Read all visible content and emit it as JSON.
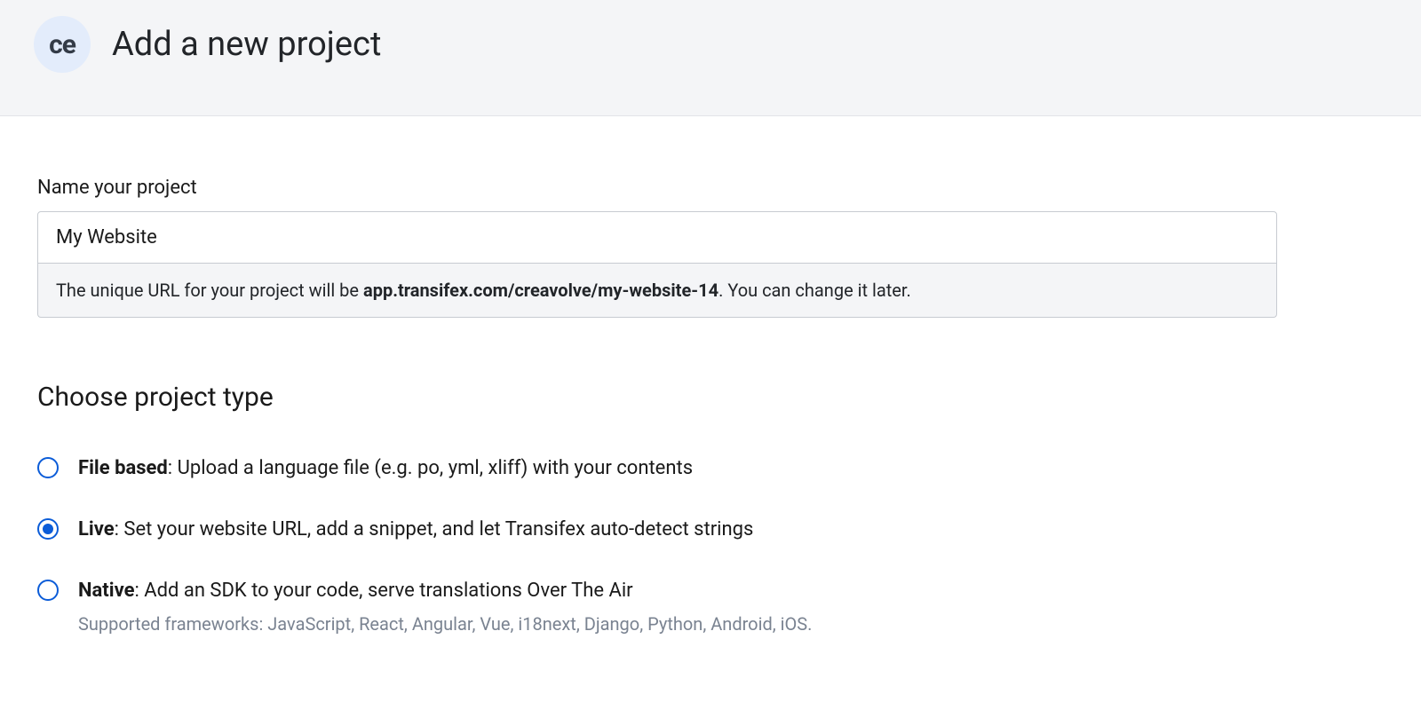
{
  "header": {
    "org_initials": "ce",
    "title": "Add a new project"
  },
  "name_section": {
    "label": "Name your project",
    "value": "My Website",
    "url_hint_prefix": "The unique URL for your project will be ",
    "url_hint_bold": "app.transifex.com/creavolve/my-website-14",
    "url_hint_suffix": ". You can change it later."
  },
  "type_section": {
    "heading": "Choose project type",
    "options": [
      {
        "name": "File based",
        "description": ": Upload a language file (e.g. po, yml, xliff) with your contents",
        "selected": false,
        "subtext": ""
      },
      {
        "name": "Live",
        "description": ": Set your website URL, add a snippet, and let Transifex auto-detect strings",
        "selected": true,
        "subtext": ""
      },
      {
        "name": "Native",
        "description": ": Add an SDK to your code, serve translations Over The Air",
        "selected": false,
        "subtext": "Supported frameworks: JavaScript, React, Angular, Vue, i18next, Django, Python, Android, iOS."
      }
    ]
  }
}
